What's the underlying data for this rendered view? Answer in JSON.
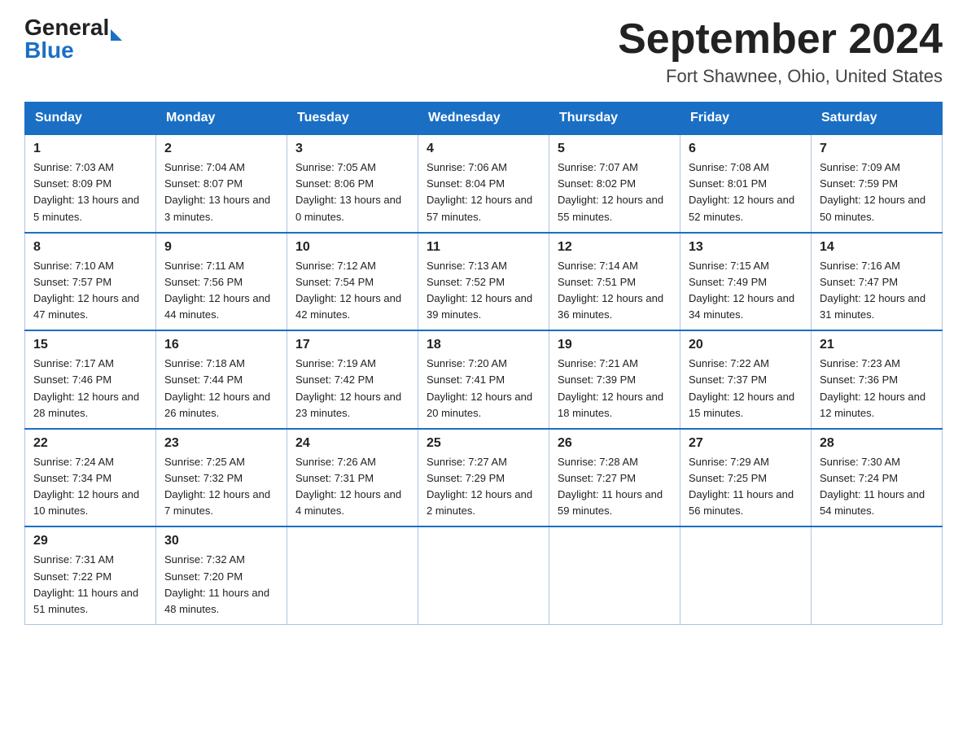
{
  "header": {
    "logo_general": "General",
    "logo_blue": "Blue",
    "title": "September 2024",
    "subtitle": "Fort Shawnee, Ohio, United States"
  },
  "days_of_week": [
    "Sunday",
    "Monday",
    "Tuesday",
    "Wednesday",
    "Thursday",
    "Friday",
    "Saturday"
  ],
  "weeks": [
    [
      {
        "day": "1",
        "sunrise": "7:03 AM",
        "sunset": "8:09 PM",
        "daylight": "13 hours and 5 minutes."
      },
      {
        "day": "2",
        "sunrise": "7:04 AM",
        "sunset": "8:07 PM",
        "daylight": "13 hours and 3 minutes."
      },
      {
        "day": "3",
        "sunrise": "7:05 AM",
        "sunset": "8:06 PM",
        "daylight": "13 hours and 0 minutes."
      },
      {
        "day": "4",
        "sunrise": "7:06 AM",
        "sunset": "8:04 PM",
        "daylight": "12 hours and 57 minutes."
      },
      {
        "day": "5",
        "sunrise": "7:07 AM",
        "sunset": "8:02 PM",
        "daylight": "12 hours and 55 minutes."
      },
      {
        "day": "6",
        "sunrise": "7:08 AM",
        "sunset": "8:01 PM",
        "daylight": "12 hours and 52 minutes."
      },
      {
        "day": "7",
        "sunrise": "7:09 AM",
        "sunset": "7:59 PM",
        "daylight": "12 hours and 50 minutes."
      }
    ],
    [
      {
        "day": "8",
        "sunrise": "7:10 AM",
        "sunset": "7:57 PM",
        "daylight": "12 hours and 47 minutes."
      },
      {
        "day": "9",
        "sunrise": "7:11 AM",
        "sunset": "7:56 PM",
        "daylight": "12 hours and 44 minutes."
      },
      {
        "day": "10",
        "sunrise": "7:12 AM",
        "sunset": "7:54 PM",
        "daylight": "12 hours and 42 minutes."
      },
      {
        "day": "11",
        "sunrise": "7:13 AM",
        "sunset": "7:52 PM",
        "daylight": "12 hours and 39 minutes."
      },
      {
        "day": "12",
        "sunrise": "7:14 AM",
        "sunset": "7:51 PM",
        "daylight": "12 hours and 36 minutes."
      },
      {
        "day": "13",
        "sunrise": "7:15 AM",
        "sunset": "7:49 PM",
        "daylight": "12 hours and 34 minutes."
      },
      {
        "day": "14",
        "sunrise": "7:16 AM",
        "sunset": "7:47 PM",
        "daylight": "12 hours and 31 minutes."
      }
    ],
    [
      {
        "day": "15",
        "sunrise": "7:17 AM",
        "sunset": "7:46 PM",
        "daylight": "12 hours and 28 minutes."
      },
      {
        "day": "16",
        "sunrise": "7:18 AM",
        "sunset": "7:44 PM",
        "daylight": "12 hours and 26 minutes."
      },
      {
        "day": "17",
        "sunrise": "7:19 AM",
        "sunset": "7:42 PM",
        "daylight": "12 hours and 23 minutes."
      },
      {
        "day": "18",
        "sunrise": "7:20 AM",
        "sunset": "7:41 PM",
        "daylight": "12 hours and 20 minutes."
      },
      {
        "day": "19",
        "sunrise": "7:21 AM",
        "sunset": "7:39 PM",
        "daylight": "12 hours and 18 minutes."
      },
      {
        "day": "20",
        "sunrise": "7:22 AM",
        "sunset": "7:37 PM",
        "daylight": "12 hours and 15 minutes."
      },
      {
        "day": "21",
        "sunrise": "7:23 AM",
        "sunset": "7:36 PM",
        "daylight": "12 hours and 12 minutes."
      }
    ],
    [
      {
        "day": "22",
        "sunrise": "7:24 AM",
        "sunset": "7:34 PM",
        "daylight": "12 hours and 10 minutes."
      },
      {
        "day": "23",
        "sunrise": "7:25 AM",
        "sunset": "7:32 PM",
        "daylight": "12 hours and 7 minutes."
      },
      {
        "day": "24",
        "sunrise": "7:26 AM",
        "sunset": "7:31 PM",
        "daylight": "12 hours and 4 minutes."
      },
      {
        "day": "25",
        "sunrise": "7:27 AM",
        "sunset": "7:29 PM",
        "daylight": "12 hours and 2 minutes."
      },
      {
        "day": "26",
        "sunrise": "7:28 AM",
        "sunset": "7:27 PM",
        "daylight": "11 hours and 59 minutes."
      },
      {
        "day": "27",
        "sunrise": "7:29 AM",
        "sunset": "7:25 PM",
        "daylight": "11 hours and 56 minutes."
      },
      {
        "day": "28",
        "sunrise": "7:30 AM",
        "sunset": "7:24 PM",
        "daylight": "11 hours and 54 minutes."
      }
    ],
    [
      {
        "day": "29",
        "sunrise": "7:31 AM",
        "sunset": "7:22 PM",
        "daylight": "11 hours and 51 minutes."
      },
      {
        "day": "30",
        "sunrise": "7:32 AM",
        "sunset": "7:20 PM",
        "daylight": "11 hours and 48 minutes."
      },
      null,
      null,
      null,
      null,
      null
    ]
  ]
}
